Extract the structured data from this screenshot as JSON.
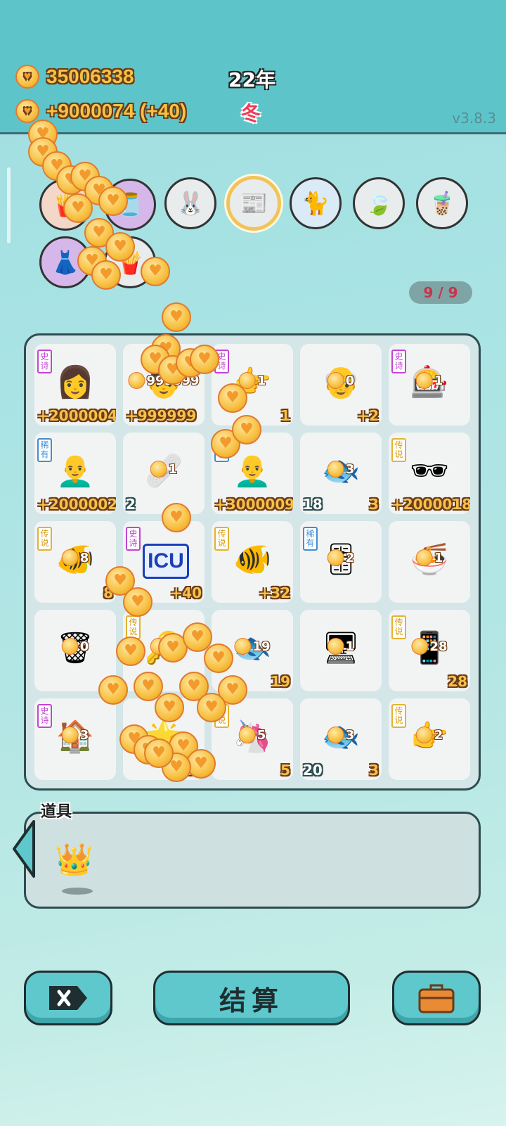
{
  "header": {
    "coins_total": "35006338",
    "coins_rate": "+9000074 (+40)",
    "year": "22年",
    "season": "冬",
    "version": "v3.8.3"
  },
  "top_icons": [
    "rabbit-icon",
    "time-magazine-icon",
    "cat-icon",
    "leaf-icon",
    "bubble-tea-icon"
  ],
  "pager": "9 / 9",
  "grid": [
    {
      "tag": "史诗",
      "tag_type": "epic",
      "art": "👩",
      "mini": "",
      "value": "+2000004",
      "count": ""
    },
    {
      "tag": "",
      "tag_type": "",
      "art": "👨",
      "mini": "999999",
      "value": "+999999",
      "count": ""
    },
    {
      "tag": "史诗",
      "tag_type": "epic",
      "art": "👉",
      "mini": "1",
      "value": "1",
      "count": ""
    },
    {
      "tag": "",
      "tag_type": "",
      "art": "👴",
      "mini": "0",
      "value": "+2",
      "count": ""
    },
    {
      "tag": "史诗",
      "tag_type": "epic",
      "art": "🎰",
      "mini": "1",
      "value": "",
      "count": ""
    },
    {
      "tag": "稀有",
      "tag_type": "rare",
      "art": "👨‍🦲",
      "mini": "",
      "value": "+2000002",
      "count": ""
    },
    {
      "tag": "",
      "tag_type": "",
      "art": "🩹",
      "mini": "1",
      "value": "",
      "count": "2"
    },
    {
      "tag": "稀有",
      "tag_type": "rare",
      "art": "👨‍🦲",
      "mini": "",
      "value": "+3000009",
      "count": ""
    },
    {
      "tag": "",
      "tag_type": "",
      "art": "🐟",
      "mini": "3",
      "value": "3",
      "count": "18"
    },
    {
      "tag": "传说",
      "tag_type": "legend",
      "art": "🕶",
      "mini": "",
      "value": "+2000018",
      "count": ""
    },
    {
      "tag": "传说",
      "tag_type": "legend",
      "art": "🐠",
      "mini": "8",
      "value": "8",
      "count": ""
    },
    {
      "tag": "史诗",
      "tag_type": "epic",
      "art": "ICU",
      "mini": "",
      "value": "+40",
      "count": ""
    },
    {
      "tag": "传说",
      "tag_type": "legend",
      "art": "🐠",
      "mini": "",
      "value": "+32",
      "count": ""
    },
    {
      "tag": "稀有",
      "tag_type": "rare",
      "art": "🎚",
      "mini": "2",
      "value": "",
      "count": ""
    },
    {
      "tag": "",
      "tag_type": "",
      "art": "🍜",
      "mini": "1",
      "value": "",
      "count": ""
    },
    {
      "tag": "",
      "tag_type": "",
      "art": "🗑",
      "mini": "0",
      "value": "",
      "count": ""
    },
    {
      "tag": "传说",
      "tag_type": "legend",
      "art": "🔑",
      "mini": "2",
      "value": "",
      "count": ""
    },
    {
      "tag": "",
      "tag_type": "",
      "art": "🐟",
      "mini": "19",
      "value": "19",
      "count": ""
    },
    {
      "tag": "",
      "tag_type": "",
      "art": "🖥",
      "mini": "1",
      "value": "",
      "count": ""
    },
    {
      "tag": "传说",
      "tag_type": "legend",
      "art": "📱",
      "mini": "28",
      "value": "28",
      "count": ""
    },
    {
      "tag": "史诗",
      "tag_type": "epic",
      "art": "🏠",
      "mini": "3",
      "value": "",
      "count": ""
    },
    {
      "tag": "",
      "tag_type": "",
      "art": "🌟",
      "mini": "",
      "value": "+21",
      "count": ""
    },
    {
      "tag": "传说",
      "tag_type": "legend",
      "art": "🦄",
      "mini": "5",
      "value": "5",
      "count": ""
    },
    {
      "tag": "",
      "tag_type": "",
      "art": "🐟",
      "mini": "3",
      "value": "3",
      "count": "20"
    },
    {
      "tag": "传说",
      "tag_type": "legend",
      "art": "👉",
      "mini": "2",
      "value": "",
      "count": ""
    }
  ],
  "items_panel": {
    "label": "道具",
    "items": [
      "crown-icon"
    ]
  },
  "buttons": {
    "close": "close-icon",
    "settle": "结算",
    "bag": "briefcase-icon"
  }
}
